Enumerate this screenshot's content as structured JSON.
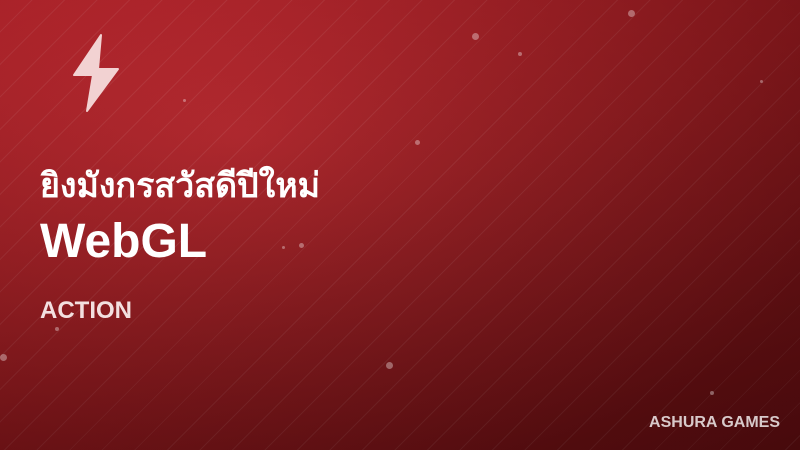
{
  "banner": {
    "title_thai": "ยิงมังกรสวัสดีปีใหม่",
    "title_main": "WebGL",
    "genre": "ACTION",
    "brand": "ASHURA GAMES",
    "icon": "lightning-bolt-icon"
  },
  "colors": {
    "background_top": "#c3222a",
    "background_bottom": "#5e0d10",
    "text": "#ffffff",
    "icon": "#f2d2d2"
  }
}
